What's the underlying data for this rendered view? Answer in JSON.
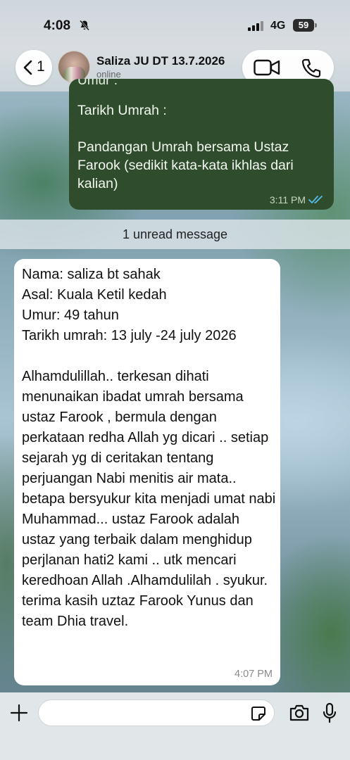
{
  "status_bar": {
    "time": "4:08",
    "network": "4G",
    "battery": "59"
  },
  "header": {
    "back_count": "1",
    "chat_name": "Saliza JU DT 13.7.2026",
    "chat_status": "online"
  },
  "messages": [
    {
      "direction": "outgoing",
      "cut_text": "Umur :",
      "text": "Tarikh Umrah :\n\nPandangan Umrah bersama Ustaz Farook (sedikit kata-kata ikhlas dari kalian)",
      "time": "3:11 PM",
      "status_icon": "double-check-read-icon"
    },
    {
      "direction": "incoming",
      "text": "Nama: saliza bt sahak\nAsal: Kuala Ketil kedah\nUmur: 49 tahun\nTarikh umrah: 13 july -24 july 2026\n\nAlhamdulillah.. terkesan dihati menunaikan ibadat umrah bersama ustaz Farook  , bermula dengan perkataan redha Allah yg dicari .. setiap sejarah yg di ceritakan  tentang perjuangan Nabi menitis air mata.. betapa bersyukur kita menjadi umat nabi Muhammad... ustaz Farook adalah ustaz yang terbaik dalam menghidup perjlanan hati2 kami .. utk mencari keredhoan Allah .Alhamdulilah . syukur. terima kasih uztaz Farook Yunus dan team Dhia travel.",
      "time": "4:07 PM"
    }
  ],
  "unread_banner": "1 unread message",
  "input": {
    "value": "",
    "placeholder": ""
  },
  "colors": {
    "outgoing_bubble": "#2f4d2d",
    "incoming_bubble": "#ffffff",
    "read_ticks": "#53bdeb"
  }
}
